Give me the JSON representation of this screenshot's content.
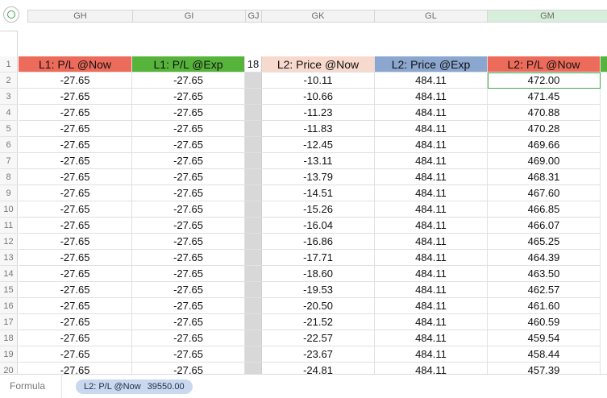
{
  "column_letters": [
    "GH",
    "GI",
    "GJ",
    "GK",
    "GL",
    "GM"
  ],
  "selected_column": "GM",
  "headers": [
    {
      "text": "L1: P/L @Now",
      "bg": "#ed6b5a"
    },
    {
      "text": "L1: P/L @Exp",
      "bg": "#56b43b"
    },
    {
      "text": "18",
      "bg": "#ffffff"
    },
    {
      "text": "L2: Price @Now",
      "bg": "#f7d9cd"
    },
    {
      "text": "L2: Price @Exp",
      "bg": "#8ba6cf"
    },
    {
      "text": "L2: P/L @Now",
      "bg": "#ed6b5a"
    }
  ],
  "row_numbers": [
    "1",
    "2",
    "3",
    "4",
    "5",
    "6",
    "7",
    "8",
    "9",
    "10",
    "11",
    "12",
    "13",
    "14",
    "15",
    "16",
    "17",
    "18",
    "19",
    "20"
  ],
  "rows": [
    [
      "-27.65",
      "-27.65",
      "",
      "-10.11",
      "484.11",
      "472.00"
    ],
    [
      "-27.65",
      "-27.65",
      "",
      "-10.66",
      "484.11",
      "471.45"
    ],
    [
      "-27.65",
      "-27.65",
      "",
      "-11.23",
      "484.11",
      "470.88"
    ],
    [
      "-27.65",
      "-27.65",
      "",
      "-11.83",
      "484.11",
      "470.28"
    ],
    [
      "-27.65",
      "-27.65",
      "",
      "-12.45",
      "484.11",
      "469.66"
    ],
    [
      "-27.65",
      "-27.65",
      "",
      "-13.11",
      "484.11",
      "469.00"
    ],
    [
      "-27.65",
      "-27.65",
      "",
      "-13.79",
      "484.11",
      "468.31"
    ],
    [
      "-27.65",
      "-27.65",
      "",
      "-14.51",
      "484.11",
      "467.60"
    ],
    [
      "-27.65",
      "-27.65",
      "",
      "-15.26",
      "484.11",
      "466.85"
    ],
    [
      "-27.65",
      "-27.65",
      "",
      "-16.04",
      "484.11",
      "466.07"
    ],
    [
      "-27.65",
      "-27.65",
      "",
      "-16.86",
      "484.11",
      "465.25"
    ],
    [
      "-27.65",
      "-27.65",
      "",
      "-17.71",
      "484.11",
      "464.39"
    ],
    [
      "-27.65",
      "-27.65",
      "",
      "-18.60",
      "484.11",
      "463.50"
    ],
    [
      "-27.65",
      "-27.65",
      "",
      "-19.53",
      "484.11",
      "462.57"
    ],
    [
      "-27.65",
      "-27.65",
      "",
      "-20.50",
      "484.11",
      "461.60"
    ],
    [
      "-27.65",
      "-27.65",
      "",
      "-21.52",
      "484.11",
      "460.59"
    ],
    [
      "-27.65",
      "-27.65",
      "",
      "-22.57",
      "484.11",
      "459.54"
    ],
    [
      "-27.65",
      "-27.65",
      "",
      "-23.67",
      "484.11",
      "458.44"
    ],
    [
      "-27.65",
      "-27.65",
      "",
      "-24.81",
      "484.11",
      "457.39"
    ]
  ],
  "selected_cell": {
    "row": 2,
    "column": "GM"
  },
  "bottom_bar": {
    "formula_label": "Formula",
    "pill_name": "L2: P/L @Now",
    "pill_value": "39550.00"
  }
}
